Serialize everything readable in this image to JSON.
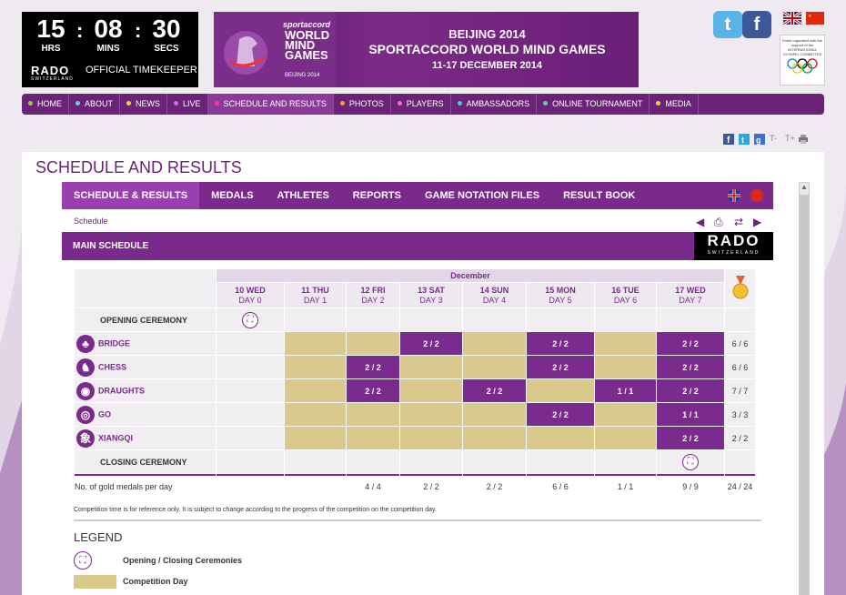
{
  "timer": {
    "hrs": "15",
    "mins": "08",
    "secs": "30",
    "hrs_label": "HRS",
    "mins_label": "MINS",
    "secs_label": "SECS",
    "sep": ":",
    "brand": "RADO",
    "brand_sub": "SWITZERLAND",
    "official": "OFFICIAL TIMEKEEPER"
  },
  "banner": {
    "tag": "sportaccord",
    "name": "WORLD MIND GAMES",
    "year": "BEIJING 2014",
    "line1": "BEIJING 2014",
    "line2": "SPORTACCORD WORLD MIND GAMES",
    "line3": "11-17 DECEMBER 2014"
  },
  "social": {
    "twitter": "t",
    "facebook": "f"
  },
  "ioc_text": "Event organised with the support of the INTERNATIONAL OLYMPIC COMMITTEE",
  "nav": [
    {
      "label": "HOME",
      "dot": "#9c3"
    },
    {
      "label": "ABOUT",
      "dot": "#6cf"
    },
    {
      "label": "NEWS",
      "dot": "#fc3"
    },
    {
      "label": "LIVE",
      "dot": "#c6f"
    },
    {
      "label": "SCHEDULE AND RESULTS",
      "dot": "#f39"
    },
    {
      "label": "PHOTOS",
      "dot": "#f93"
    },
    {
      "label": "PLAYERS",
      "dot": "#f6c"
    },
    {
      "label": "AMBASSADORS",
      "dot": "#3cf"
    },
    {
      "label": "ONLINE TOURNAMENT",
      "dot": "#6c9"
    },
    {
      "label": "MEDIA",
      "dot": "#fc3"
    }
  ],
  "share": {
    "font_smaller": "T-",
    "font_bigger": "T+"
  },
  "page_title": "SCHEDULE AND RESULTS",
  "subnav": [
    "SCHEDULE & RESULTS",
    "MEDALS",
    "ATHLETES",
    "REPORTS",
    "GAME NOTATION FILES",
    "RESULT BOOK"
  ],
  "breadcrumb": "Schedule",
  "main_schedule_title": "MAIN SCHEDULE",
  "rado": {
    "name": "RADO",
    "sub": "SWITZERLAND"
  },
  "schedule": {
    "month": "December",
    "days": [
      {
        "date": "10 WED",
        "day": "DAY 0"
      },
      {
        "date": "11 THU",
        "day": "DAY 1"
      },
      {
        "date": "12 FRI",
        "day": "DAY 2"
      },
      {
        "date": "13 SAT",
        "day": "DAY 3"
      },
      {
        "date": "14 SUN",
        "day": "DAY 4"
      },
      {
        "date": "15 MON",
        "day": "DAY 5"
      },
      {
        "date": "16 TUE",
        "day": "DAY 6"
      },
      {
        "date": "17 WED",
        "day": "DAY 7"
      }
    ],
    "rows": [
      {
        "name": "OPENING CEREMONY",
        "type": "ceremony",
        "cells": [
          "C",
          "",
          "",
          "",
          "",
          "",
          "",
          ""
        ],
        "total": ""
      },
      {
        "name": "BRIDGE",
        "type": "sport",
        "icon": "♣",
        "cells": [
          "",
          "D",
          "D",
          "2 / 2",
          "D",
          "2 / 2",
          "D",
          "2 / 2"
        ],
        "total": "6 / 6"
      },
      {
        "name": "CHESS",
        "type": "sport",
        "icon": "♞",
        "cells": [
          "",
          "D",
          "2 / 2",
          "D",
          "D",
          "2 / 2",
          "D",
          "2 / 2"
        ],
        "total": "6 / 6"
      },
      {
        "name": "DRAUGHTS",
        "type": "sport",
        "icon": "◉",
        "cells": [
          "",
          "D",
          "2 / 2",
          "D",
          "2 / 2",
          "D",
          "1 / 1",
          "2 / 2"
        ],
        "total": "7 / 7"
      },
      {
        "name": "GO",
        "type": "sport",
        "icon": "◎",
        "cells": [
          "",
          "D",
          "D",
          "D",
          "D",
          "2 / 2",
          "D",
          "1 / 1"
        ],
        "total": "3 / 3"
      },
      {
        "name": "XIANGQI",
        "type": "sport",
        "icon": "象",
        "cells": [
          "",
          "D",
          "D",
          "D",
          "D",
          "D",
          "D",
          "2 / 2"
        ],
        "total": "2 / 2"
      },
      {
        "name": "CLOSING CEREMONY",
        "type": "ceremony",
        "cells": [
          "",
          "",
          "",
          "",
          "",
          "",
          "",
          "C"
        ],
        "total": ""
      }
    ],
    "gold_label": "No. of gold medals per day",
    "gold_per_day": [
      "",
      "",
      "4 / 4",
      "2 / 2",
      "2 / 2",
      "6 / 6",
      "1 / 1",
      "9 / 9"
    ],
    "gold_total": "24 / 24"
  },
  "note": "Competition time is for reference only. It is subject to change according to the progress of the competition on the competition day.",
  "legend": {
    "title": "LEGEND",
    "ceremonies": "Opening / Closing Ceremonies",
    "competition_day": "Competition Day"
  }
}
